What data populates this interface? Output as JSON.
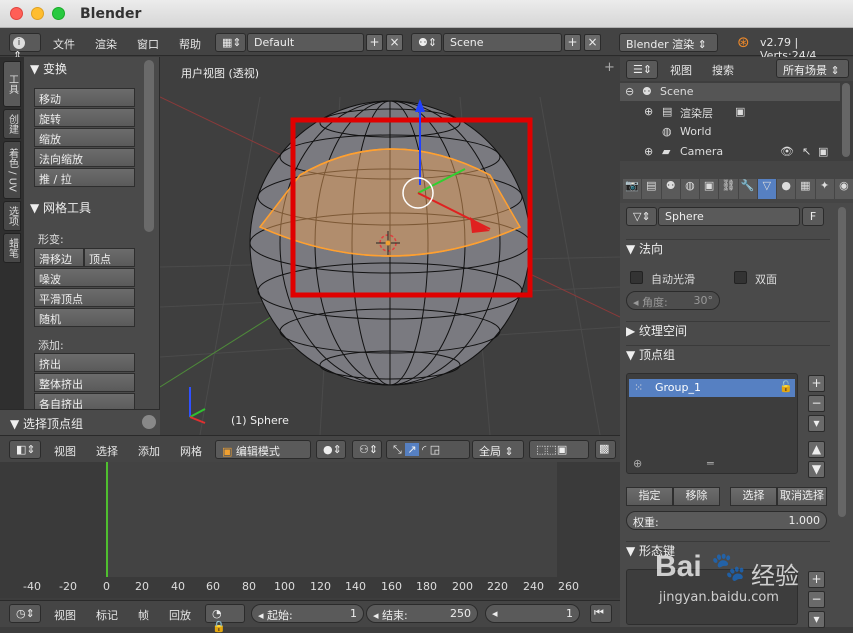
{
  "window": {
    "title": "Blender"
  },
  "info": {
    "menus": [
      "文件",
      "渲染",
      "窗口",
      "帮助"
    ],
    "layout": "Default",
    "scene": "Scene",
    "engine": "Blender 渲染",
    "version": "v2.79 | Verts:24/4"
  },
  "tabs": [
    "工具",
    "创建",
    "关系",
    "着色 / UV",
    "选项",
    "蜡笔"
  ],
  "toolshelf": {
    "transform_title": "变换",
    "transform": [
      "移动",
      "旋转",
      "缩放",
      "法向缩放",
      "推 / 拉"
    ],
    "mesh_title": "网格工具",
    "deform_label": "形变:",
    "slide_edge": "滑移边",
    "slide_vertex": "顶点",
    "deform": [
      "噪波",
      "平滑顶点",
      "随机"
    ],
    "add_label": "添加:",
    "add": [
      "挤出",
      "整体挤出",
      "各自挤出"
    ],
    "operator_title": "选择顶点组"
  },
  "viewport": {
    "title": "用户视图 (透视)",
    "object": "(1) Sphere"
  },
  "view3d_header": {
    "menus": [
      "视图",
      "选择",
      "添加",
      "网格"
    ],
    "mode": "编辑模式",
    "pivot": "全局"
  },
  "timeline": {
    "ticks": [
      "-40",
      "-20",
      "0",
      "20",
      "40",
      "60",
      "80",
      "100",
      "120",
      "140",
      "160",
      "180",
      "200",
      "220",
      "240",
      "260"
    ]
  },
  "timeline_header": {
    "menus": [
      "视图",
      "标记",
      "帧",
      "回放"
    ],
    "start_label": "起始:",
    "start": "1",
    "end_label": "结束:",
    "end": "250",
    "current": "1"
  },
  "outliner": {
    "menus": [
      "视图",
      "搜索"
    ],
    "filter": "所有场景",
    "items": [
      "Scene",
      "渲染层",
      "World",
      "Camera"
    ]
  },
  "props": {
    "datablock": "Sphere",
    "fake_user": "F",
    "normals_title": "法向",
    "auto_smooth": "自动光滑",
    "double_sided": "双面",
    "angle": "角度:",
    "angle_value": "30°",
    "texture_space": "纹理空间",
    "vertex_groups": "顶点组",
    "group_name": "Group_1",
    "assign": "指定",
    "remove": "移除",
    "select": "选择",
    "deselect": "取消选择",
    "weight_label": "权重:",
    "weight_value": "1.000",
    "shape_keys": "形态键"
  },
  "watermark": {
    "brand": "Bai",
    "brand2": "经验",
    "url": "jingyan.baidu.com"
  },
  "colors": {
    "accent": "#5680c2",
    "selection_box": "#e00000",
    "selected_face": "#f0a050"
  }
}
